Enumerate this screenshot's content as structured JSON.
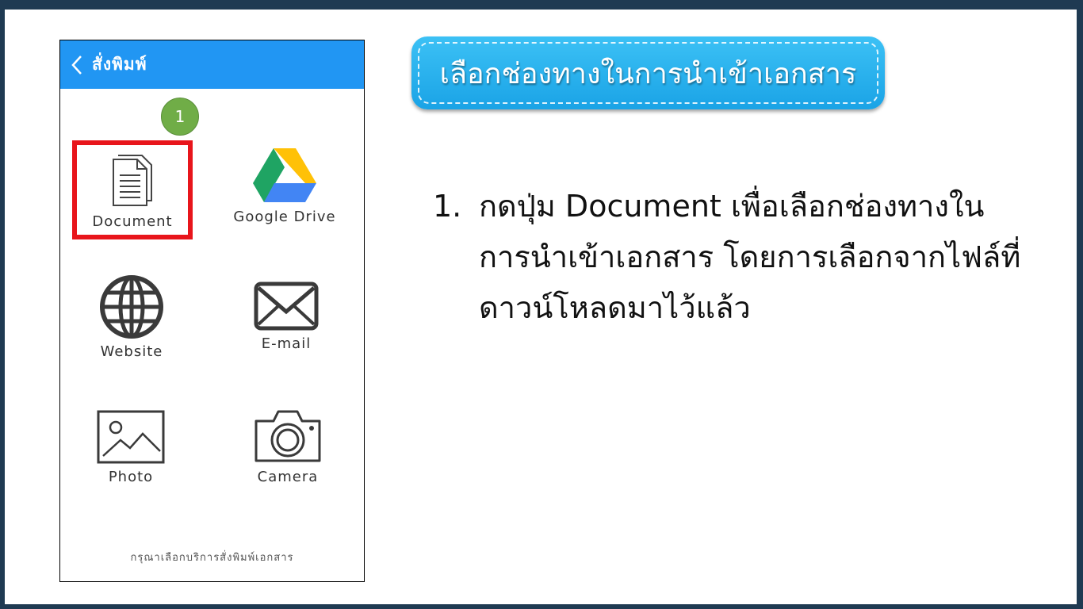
{
  "phone": {
    "title": "สั่งพิมพ์",
    "step_badge": "1",
    "options": [
      {
        "label": "Document",
        "icon": "document-icon"
      },
      {
        "label": "Google Drive",
        "icon": "google-drive-icon"
      },
      {
        "label": "Website",
        "icon": "globe-icon"
      },
      {
        "label": "E-mail",
        "icon": "envelope-icon"
      },
      {
        "label": "Photo",
        "icon": "image-icon"
      },
      {
        "label": "Camera",
        "icon": "camera-icon"
      }
    ],
    "footer": "กรุณาเลือกบริการสั่งพิมพ์เอกสาร"
  },
  "banner": {
    "title": "เลือกช่องทางในการนำเข้าเอกสาร"
  },
  "instruction": {
    "number": "1.",
    "text": "กดปุ่ม Document เพื่อเลือกช่องทางในการนำเข้าเอกสาร โดยการเลือกจากไฟล์ที่ดาวน์โหลดมาไว้แล้ว"
  },
  "colors": {
    "header_blue": "#2196f3",
    "highlight_red": "#e8151b",
    "badge_green": "#70ad47",
    "banner_blue": "#1aa3e6"
  }
}
